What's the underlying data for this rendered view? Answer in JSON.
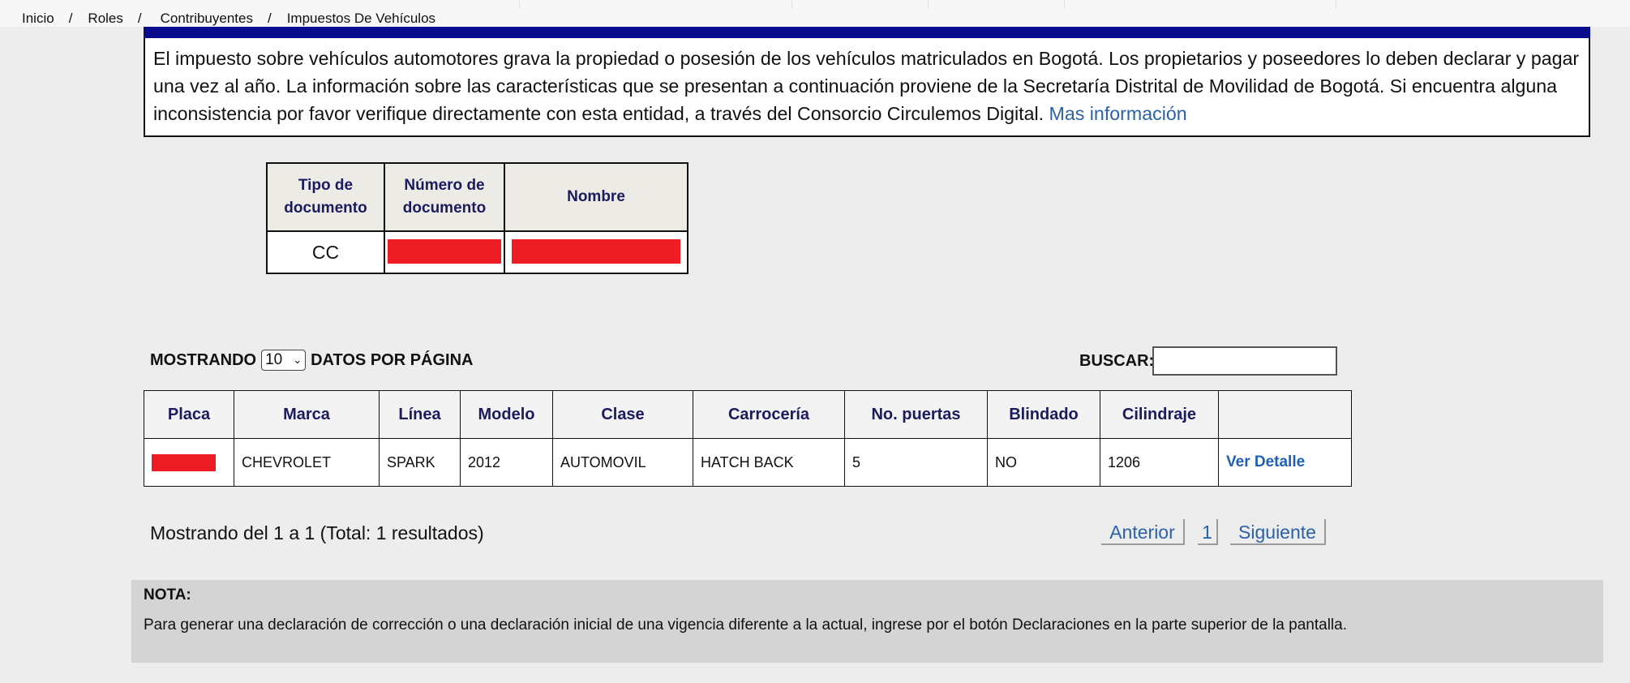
{
  "breadcrumb": [
    "Inicio",
    "Roles",
    "Contribuyentes",
    "Impuestos De Vehículos"
  ],
  "breadcrumb_separator": "/",
  "info": {
    "text": "El impuesto sobre vehículos automotores grava la propiedad o posesión de los vehículos matriculados en Bogotá. Los propietarios y poseedores lo deben declarar y pagar una vez al año. La información sobre las características que se presentan a continuación proviene de la Secretaría Distrital de Movilidad de Bogotá. Si encuentra alguna inconsistencia por favor verifique directamente con esta entidad, a través del Consorcio Circulemos Digital.",
    "link": "Mas información"
  },
  "person_table": {
    "headers": [
      "Tipo de documento",
      "Número de documento",
      "Nombre"
    ],
    "row": {
      "tipo": "CC"
    }
  },
  "controls": {
    "show_label": "MOSTRANDO",
    "page_size": "10",
    "per_page_label": "DATOS POR PÁGINA",
    "search_label": "BUSCAR:"
  },
  "vehicle_table": {
    "headers": [
      "Placa",
      "Marca",
      "Línea",
      "Modelo",
      "Clase",
      "Carrocería",
      "No. puertas",
      "Blindado",
      "Cilindraje",
      ""
    ],
    "rows": [
      {
        "marca": "CHEVROLET",
        "linea": "SPARK",
        "modelo": "2012",
        "clase": "AUTOMOVIL",
        "carroceria": "HATCH BACK",
        "puertas": "5",
        "blindado": "NO",
        "cilindraje": "1206",
        "accion": "Ver Detalle"
      }
    ]
  },
  "results_text": "Mostrando del 1 a 1 (Total: 1 resultados)",
  "pagination": {
    "prev": "Anterior",
    "current": "1",
    "next": "Siguiente"
  },
  "note": {
    "title": "NOTA:",
    "text": "Para generar una declaración de corrección o una declaración inicial de una vigencia diferente a la actual, ingrese por el botón Declaraciones en la parte superior de la pantalla."
  },
  "colors": {
    "accent_bar": "#0a0a8c",
    "redaction": "#ee1c25",
    "link": "#2a62a8",
    "header_text": "#1b1b5e"
  }
}
